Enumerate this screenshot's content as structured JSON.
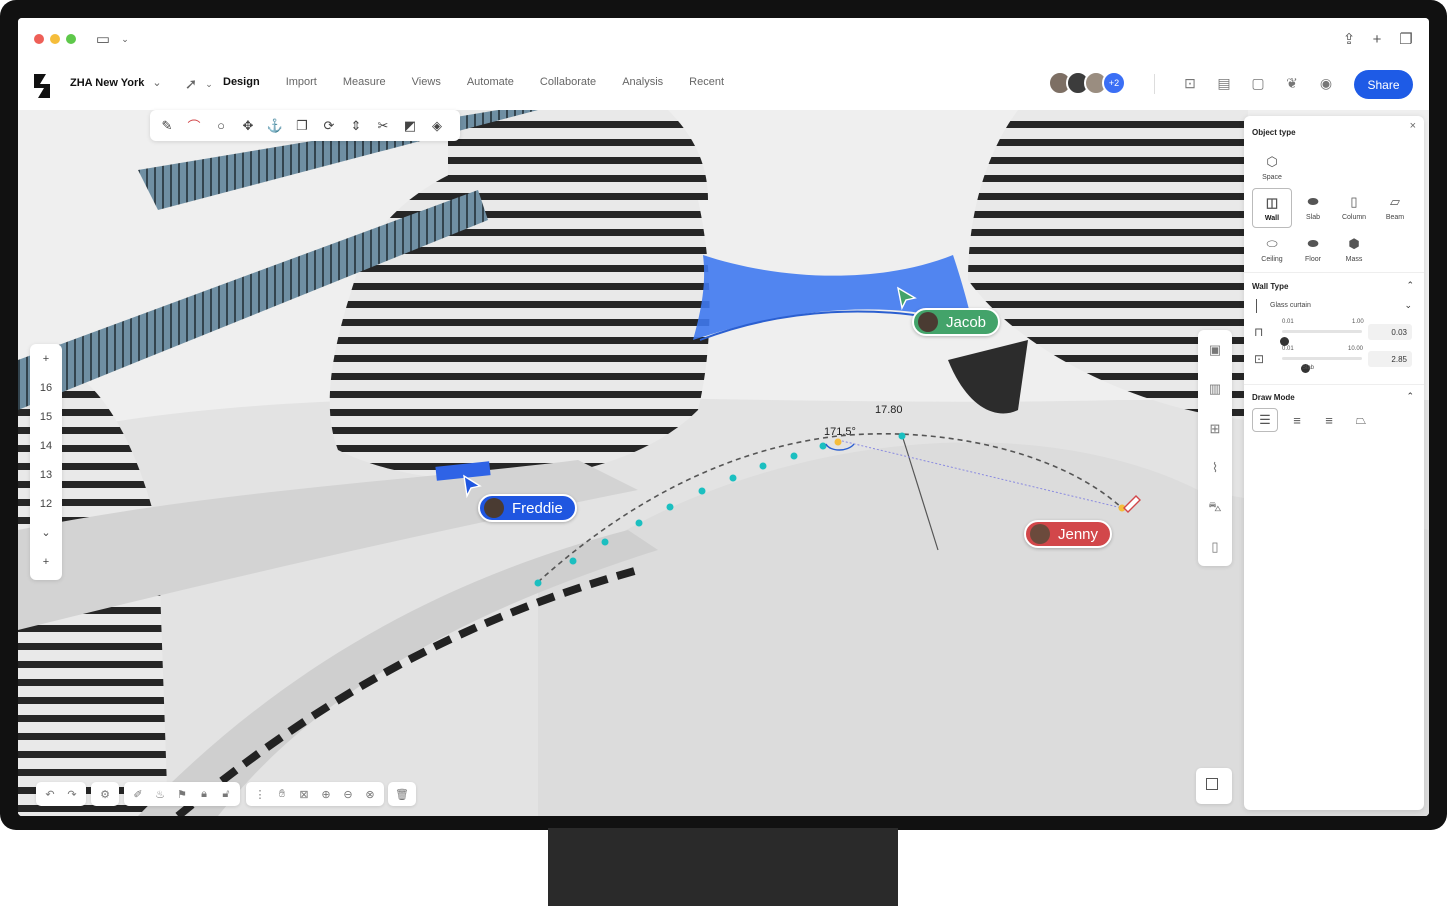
{
  "project": {
    "name": "ZHA New York"
  },
  "nav": {
    "tabs": [
      "Design",
      "Import",
      "Measure",
      "Views",
      "Automate",
      "Collaborate",
      "Analysis",
      "Recent"
    ],
    "active": "Design"
  },
  "collaborators": {
    "extra_count": "+2"
  },
  "share_label": "Share",
  "floors": {
    "levels": [
      "16",
      "15",
      "14",
      "13",
      "12"
    ]
  },
  "measurements": {
    "length": "17.80",
    "angle": "171.5°"
  },
  "users": {
    "jacob": {
      "name": "Jacob",
      "color": "#43a36a"
    },
    "freddie": {
      "name": "Freddie",
      "color": "#1f56e0"
    },
    "jenny": {
      "name": "Jenny",
      "color": "#d2474a"
    }
  },
  "panel": {
    "object_type_title": "Object type",
    "object_types": [
      {
        "label": "Space",
        "selected": false
      },
      {
        "label": "Wall",
        "selected": true
      },
      {
        "label": "Slab",
        "selected": false
      },
      {
        "label": "Column",
        "selected": false
      },
      {
        "label": "Beam",
        "selected": false
      },
      {
        "label": "Ceiling",
        "selected": false
      },
      {
        "label": "Floor",
        "selected": false
      },
      {
        "label": "Mass",
        "selected": false
      }
    ],
    "wall_type_title": "Wall Type",
    "wall_type_value": "Glass curtain",
    "slider1": {
      "min": "0.01",
      "max": "1.00",
      "value": "0.03",
      "level": 0.03
    },
    "slider2": {
      "min": "0.01",
      "max": "10.00",
      "value": "2.85",
      "label": "Slab",
      "level": 0.285
    },
    "draw_mode_title": "Draw Mode"
  },
  "colors": {
    "accent": "#1e5be6",
    "selection": "#3f79f0",
    "measure_points": "#1bbfc0"
  }
}
